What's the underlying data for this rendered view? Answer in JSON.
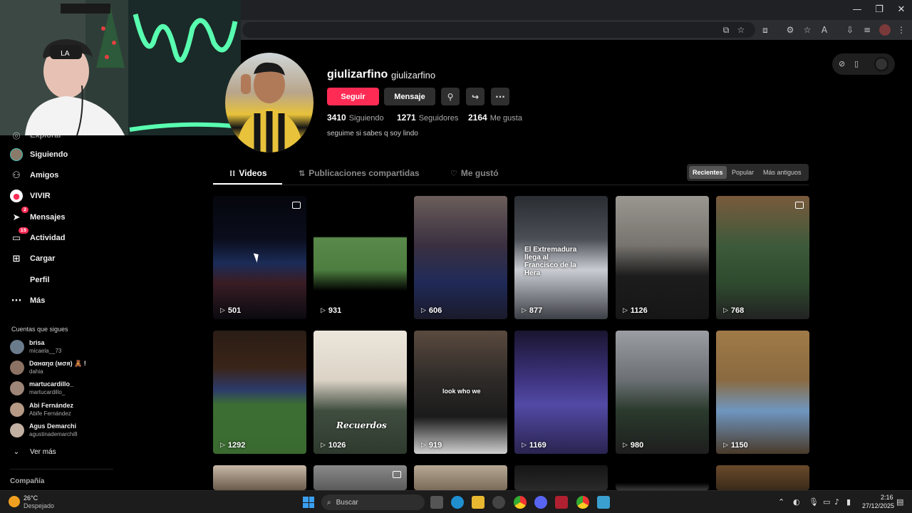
{
  "profile": {
    "username": "giulizarfino",
    "nickname": "giulizarfino",
    "follow_label": "Seguir",
    "message_label": "Mensaje",
    "bio": "seguime si sabes q soy lindo",
    "stats": [
      {
        "value": "3410",
        "label": "Siguiendo"
      },
      {
        "value": "1271",
        "label": "Seguidores"
      },
      {
        "value": "2164",
        "label": "Me gusta"
      }
    ]
  },
  "tabs": [
    {
      "label": "Videos",
      "active": true
    },
    {
      "label": "Publicaciones compartidas",
      "active": false
    },
    {
      "label": "Me gustó",
      "active": false
    }
  ],
  "sort": [
    "Recientes",
    "Popular",
    "Más antiguos"
  ],
  "sidebar": {
    "items": [
      {
        "label": "Explorar",
        "icon": "compass-icon"
      },
      {
        "label": "Siguiendo",
        "icon": "following-avatar-icon"
      },
      {
        "label": "Amigos",
        "icon": "friends-icon"
      },
      {
        "label": "VIVIR",
        "icon": "live-icon"
      },
      {
        "label": "Mensajes",
        "icon": "messages-icon",
        "badge": "2"
      },
      {
        "label": "Actividad",
        "icon": "activity-icon",
        "badge": "15"
      },
      {
        "label": "Cargar",
        "icon": "upload-icon"
      },
      {
        "label": "Perfil",
        "icon": "profile-icon"
      },
      {
        "label": "Más",
        "icon": "more-icon"
      }
    ],
    "following_header": "Cuentas que sigues",
    "following": [
      {
        "name": "brisa",
        "handle": "micaela__73",
        "color": "#6a7b8c"
      },
      {
        "name": "Dαнαηα (мσя) 🧸 !",
        "handle": "dahia",
        "color": "#8c7263"
      },
      {
        "name": "martucardillo_",
        "handle": "martucardillo_",
        "color": "#9d8578"
      },
      {
        "name": "Abi Fernández",
        "handle": "Abife Fernández",
        "color": "#b69a86"
      },
      {
        "name": "Agus Demarchi",
        "handle": "agustinademarchi8",
        "color": "#c2b0a2"
      }
    ],
    "see_more": "Ver más",
    "company": "Compañía"
  },
  "videos": [
    {
      "views": "501",
      "pinned": true,
      "bg": "linear-gradient(180deg,#05060d 0%,#0a0d1c 35%,#1b2c58 55%,#3a1d24 70%,#0a0a10 100%)",
      "text": ""
    },
    {
      "views": "931",
      "pinned": false,
      "bg": "linear-gradient(180deg,#000 0%,#000 33%,#5a8a4b 34%,#4d7e3f 60%,#000 77%,#000 100%)",
      "text": ""
    },
    {
      "views": "606",
      "pinned": false,
      "bg": "linear-gradient(180deg,#6b5d5a 0%,#3a3040 40%,#202a58 70%,#1a1a2a 100%)",
      "text": ""
    },
    {
      "views": "877",
      "pinned": false,
      "bg": "linear-gradient(180deg,#2a2e33 0%,#4a4e55 35%,#c9ccd2 60%,#3c3f45 100%)",
      "text": "El Extremadura llega al Francisco de la Hera"
    },
    {
      "views": "1126",
      "pinned": false,
      "bg": "linear-gradient(180deg,#9a9690 0%,#77746f 40%,#1c1c1c 65%,#161616 100%)",
      "text": ""
    },
    {
      "views": "768",
      "pinned": true,
      "bg": "linear-gradient(180deg,#7a5a3d 0%,#3d5a3a 40%,#2f4b2f 70%,#222 100%)",
      "text": ""
    },
    {
      "views": "1292",
      "pinned": false,
      "bg": "linear-gradient(180deg,#2a1d15 0%,#3a2418 30%,#2c3a6a 48%,#3c6e33 60%,#3a6a30 100%)",
      "text": ""
    },
    {
      "views": "1026",
      "pinned": false,
      "bg": "linear-gradient(180deg,#ece6dc 0%,#dcd3c6 40%,#3f4d3f 65%,#2f3a2f 100%)",
      "text": "Recuerdos"
    },
    {
      "views": "919",
      "pinned": false,
      "bg": "linear-gradient(180deg,#5a4a3e 0%,#2e2a28 40%,#1b1b1b 70%,#cfcfcf 100%)",
      "text": "look who we"
    },
    {
      "views": "1169",
      "pinned": false,
      "bg": "linear-gradient(180deg,#1a1530 0%,#3e3480 40%,#524aa5 60%,#2a2450 100%)",
      "text": ""
    },
    {
      "views": "980",
      "pinned": false,
      "bg": "linear-gradient(180deg,#9a9ea3 0%,#6c7075 40%,#2a3a2c 65%,#1e1e1e 100%)",
      "text": ""
    },
    {
      "views": "1150",
      "pinned": false,
      "bg": "linear-gradient(180deg,#a07a48 0%,#8a6a40 40%,#6f96c0 65%,#4a3a2a 100%)",
      "text": ""
    },
    {
      "views": "",
      "pinned": false,
      "bg": "linear-gradient(180deg,#c8b8a8 0%,#6a5a4a 100%)",
      "text": ""
    },
    {
      "views": "",
      "pinned": true,
      "bg": "linear-gradient(180deg,#8a8a8a 0%,#5a5a5a 100%)",
      "text": ""
    },
    {
      "views": "",
      "pinned": false,
      "bg": "linear-gradient(180deg,#b7a894 0%,#7a6a58 100%)",
      "text": ""
    },
    {
      "views": "",
      "pinned": false,
      "bg": "linear-gradient(180deg,#151515 0%,#2a2a2a 100%)",
      "text": ""
    },
    {
      "views": "",
      "pinned": false,
      "bg": "linear-gradient(180deg,#000 0%,#000 70%,#3a3a3a 100%)",
      "text": ""
    },
    {
      "views": "",
      "pinned": false,
      "bg": "linear-gradient(180deg,#6a4a2a 0%,#3a2a1a 100%)",
      "text": ""
    }
  ],
  "taskbar": {
    "weather_temp": "26°C",
    "weather_desc": "Despejado",
    "search_placeholder": "Buscar",
    "time": "2:16",
    "date": "27/12/2025"
  },
  "colors": {
    "accent": "#fe2c55",
    "background": "#000000"
  }
}
